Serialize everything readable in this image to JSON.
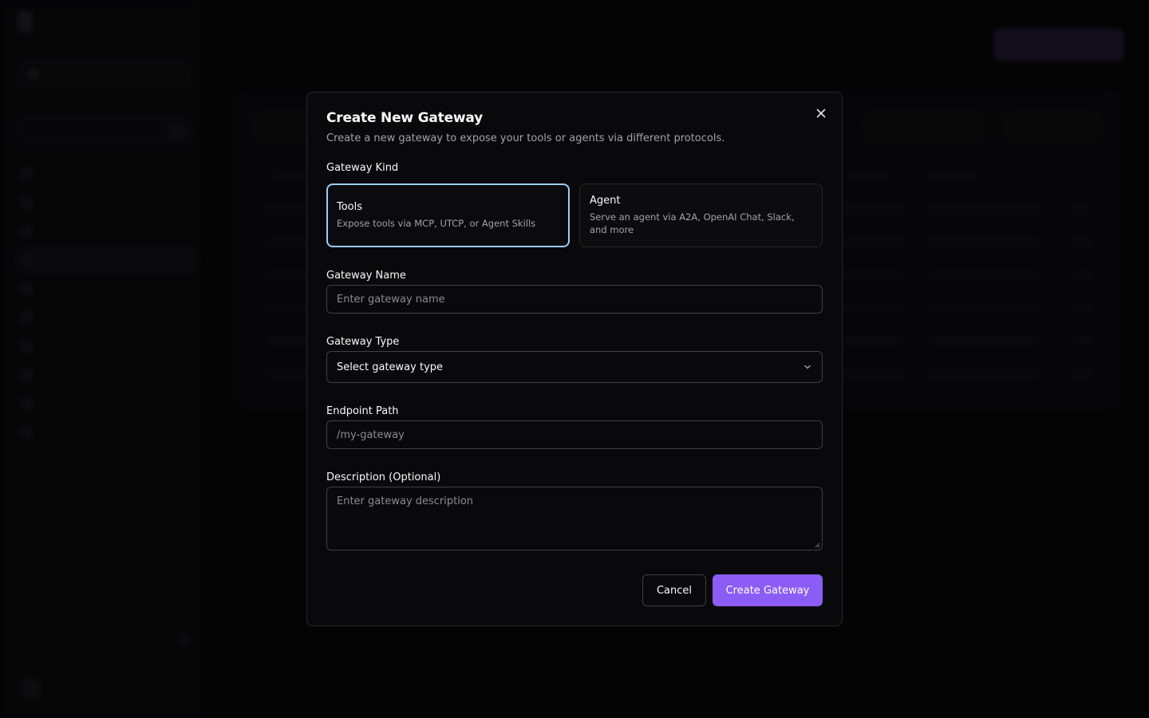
{
  "colors": {
    "accent": "#8b5cf6",
    "selected_border": "#9ecbff",
    "background": "#09090b"
  },
  "modal": {
    "title": "Create New Gateway",
    "description": "Create a new gateway to expose your tools or agents via different protocols.",
    "close_icon": "close-icon",
    "kind": {
      "label": "Gateway Kind",
      "selected": "Tools",
      "options": [
        {
          "name": "Tools",
          "description": "Expose tools via MCP, UTCP, or Agent Skills"
        },
        {
          "name": "Agent",
          "description": "Serve an agent via A2A, OpenAI Chat, Slack, and more"
        }
      ]
    },
    "name": {
      "label": "Gateway Name",
      "placeholder": "Enter gateway name"
    },
    "type": {
      "label": "Gateway Type",
      "value": "Select gateway type",
      "icon": "chevron-down-icon"
    },
    "endpoint": {
      "label": "Endpoint Path",
      "placeholder": "/my-gateway"
    },
    "description_field": {
      "label": "Description (Optional)",
      "placeholder": "Enter gateway description"
    },
    "actions": {
      "cancel": "Cancel",
      "create": "Create Gateway"
    }
  }
}
